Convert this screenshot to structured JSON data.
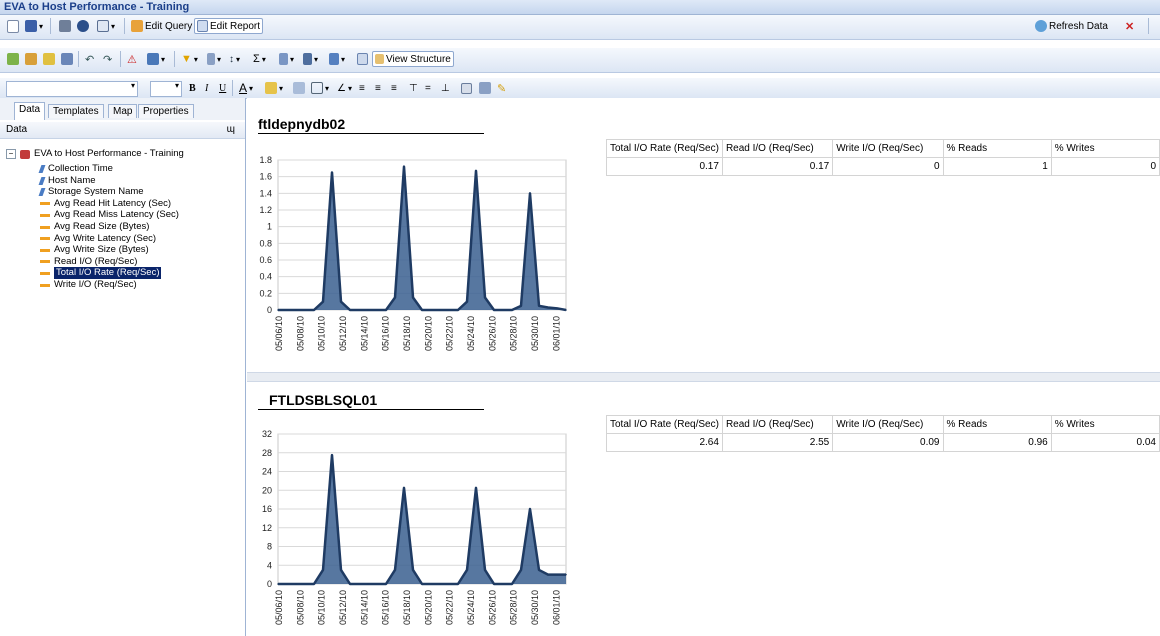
{
  "window": {
    "title": "EVA to Host Performance - Training"
  },
  "toolbar1": {
    "edit_query": "Edit Query",
    "edit_report": "Edit Report",
    "refresh": "Refresh Data"
  },
  "toolbar2": {
    "view_structure": "View Structure"
  },
  "panel": {
    "tabs": [
      "Data",
      "Templates",
      "Map",
      "Properties"
    ],
    "header": "Data",
    "pin": "ɰ",
    "tree": {
      "root": "EVA to Host Performance - Training",
      "items": [
        {
          "label": "Collection Time",
          "kind": "dim"
        },
        {
          "label": "Host Name",
          "kind": "dim"
        },
        {
          "label": "Storage System Name",
          "kind": "dim"
        },
        {
          "label": "Avg Read Hit Latency (Sec)",
          "kind": "meas"
        },
        {
          "label": "Avg Read Miss Latency (Sec)",
          "kind": "meas"
        },
        {
          "label": "Avg Read Size (Bytes)",
          "kind": "meas"
        },
        {
          "label": "Avg Write Latency (Sec)",
          "kind": "meas"
        },
        {
          "label": "Avg Write Size (Bytes)",
          "kind": "meas"
        },
        {
          "label": "Read I/O (Req/Sec)",
          "kind": "meas"
        },
        {
          "label": "Total I/O Rate (Req/Sec)",
          "kind": "meas",
          "selected": true
        },
        {
          "label": "Write I/O (Req/Sec)",
          "kind": "meas"
        }
      ]
    }
  },
  "reports": [
    {
      "host": "ftldepnydb02",
      "stats": {
        "headers": [
          "Total I/O Rate (Req/Sec)",
          "Read I/O (Req/Sec)",
          "Write I/O (Req/Sec)",
          "% Reads",
          "% Writes"
        ],
        "values": [
          "0.17",
          "0.17",
          "0",
          "1",
          "0"
        ]
      }
    },
    {
      "host": "FTLDSBLSQL01",
      "stats": {
        "headers": [
          "Total I/O Rate (Req/Sec)",
          "Read I/O (Req/Sec)",
          "Write I/O (Req/Sec)",
          "% Reads",
          "% Writes"
        ],
        "values": [
          "2.64",
          "2.55",
          "0.09",
          "0.96",
          "0.04"
        ]
      }
    }
  ],
  "colors": {
    "line": "#1f3b63",
    "fill": "#3a5f8f",
    "selection": "#0a246a"
  },
  "chart_data": [
    {
      "type": "area",
      "title": "",
      "xlabel": "",
      "ylabel": "",
      "categories": [
        "05/06/10",
        "05/08/10",
        "05/10/10",
        "05/12/10",
        "05/14/10",
        "05/16/10",
        "05/18/10",
        "05/20/10",
        "05/22/10",
        "05/24/10",
        "05/26/10",
        "05/28/10",
        "05/30/10",
        "06/01/10"
      ],
      "y_ticks": [
        "0",
        "0.2",
        "0.4",
        "0.6",
        "0.8",
        "1",
        "1.2",
        "1.4",
        "1.6",
        "1.8"
      ],
      "ylim": [
        0,
        1.8
      ],
      "grid": true,
      "series": [
        {
          "x": [
            0,
            1,
            2,
            2.5,
            3,
            3.5,
            4,
            5,
            6,
            6.5,
            7,
            7.5,
            8,
            9,
            10,
            10.5,
            11,
            11.5,
            12,
            13,
            13.5,
            14,
            14.5,
            15,
            15.5,
            16
          ],
          "values": [
            0,
            0,
            0,
            0.1,
            1.65,
            0.1,
            0,
            0,
            0,
            0.15,
            1.72,
            0.15,
            0,
            0,
            0,
            0.1,
            1.67,
            0.15,
            0,
            0,
            0.05,
            1.4,
            0.05,
            0.03,
            0.02,
            0
          ]
        }
      ]
    },
    {
      "type": "area",
      "title": "",
      "xlabel": "",
      "ylabel": "",
      "categories": [
        "05/06/10",
        "05/08/10",
        "05/10/10",
        "05/12/10",
        "05/14/10",
        "05/16/10",
        "05/18/10",
        "05/20/10",
        "05/22/10",
        "05/24/10",
        "05/26/10",
        "05/28/10",
        "05/30/10",
        "06/01/10"
      ],
      "y_ticks": [
        "0",
        "4",
        "8",
        "12",
        "16",
        "20",
        "24",
        "28",
        "32"
      ],
      "ylim": [
        0,
        32
      ],
      "grid": true,
      "series": [
        {
          "x": [
            0,
            1,
            2,
            2.5,
            3,
            3.5,
            4,
            5,
            6,
            6.5,
            7,
            7.5,
            8,
            9,
            10,
            10.5,
            11,
            11.5,
            12,
            13,
            13.5,
            14,
            14.5,
            15,
            15.5,
            16
          ],
          "values": [
            0,
            0,
            0,
            3,
            27.5,
            3,
            0,
            0,
            0,
            3,
            20.5,
            3,
            0,
            0,
            0,
            3,
            20.5,
            3,
            0,
            0,
            3,
            16,
            3,
            2,
            2,
            2
          ]
        }
      ]
    }
  ]
}
